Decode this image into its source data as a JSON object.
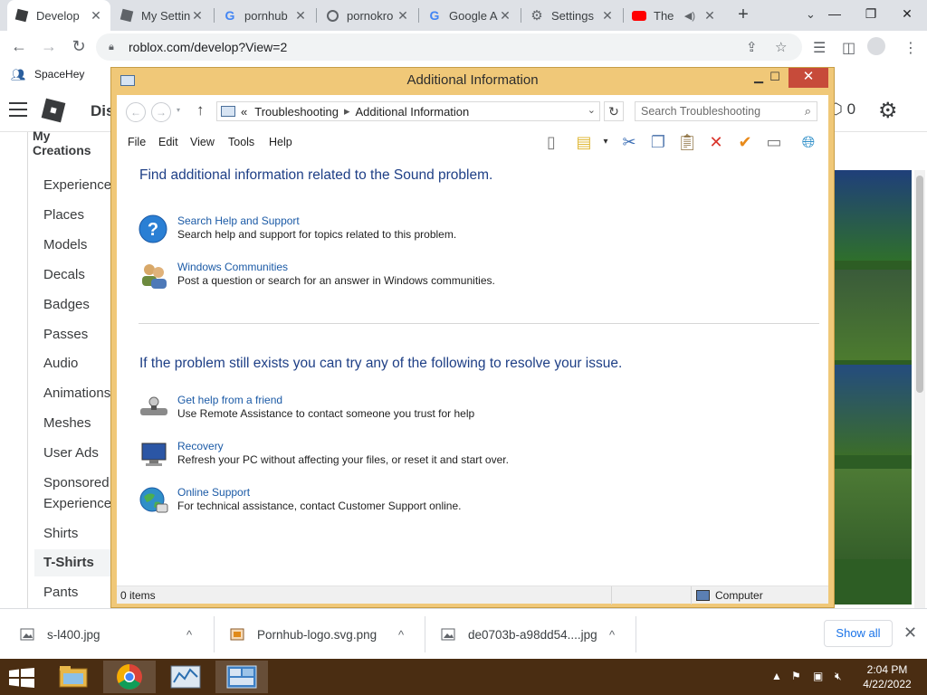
{
  "browser": {
    "tabs": [
      {
        "title": "Develop",
        "icon": "roblox-icon",
        "active": true
      },
      {
        "title": "My Settin",
        "icon": "roblox-icon",
        "active": false
      },
      {
        "title": "pornhub",
        "icon": "google-icon",
        "active": false
      },
      {
        "title": "pornokro",
        "icon": "globe-icon",
        "active": false
      },
      {
        "title": "Google A",
        "icon": "google-icon",
        "active": false
      },
      {
        "title": "Settings",
        "icon": "gear-icon",
        "active": false
      },
      {
        "title": "The",
        "icon": "youtube-icon",
        "active": false
      }
    ],
    "url": "roblox.com/develop?View=2",
    "bookmarks": [
      {
        "label": "SpaceHey"
      }
    ]
  },
  "roblox": {
    "header_title": "Dis",
    "robux": "0",
    "my_creations": "My Creations",
    "sidebar": [
      {
        "label": "Experiences"
      },
      {
        "label": "Places"
      },
      {
        "label": "Models"
      },
      {
        "label": "Decals"
      },
      {
        "label": "Badges"
      },
      {
        "label": "Passes"
      },
      {
        "label": "Audio"
      },
      {
        "label": "Animations"
      },
      {
        "label": "Meshes"
      },
      {
        "label": "User Ads"
      },
      {
        "label": "Sponsored"
      },
      {
        "label": "Experience"
      },
      {
        "label": "Shirts"
      },
      {
        "label": "T-Shirts",
        "active": true
      },
      {
        "label": "Pants"
      }
    ]
  },
  "dialog": {
    "title": "Additional Information",
    "address": {
      "prefix": "«",
      "crumbs": [
        "Troubleshooting",
        "Additional Information"
      ]
    },
    "search_placeholder": "Search Troubleshooting",
    "menu": [
      "File",
      "Edit",
      "View",
      "Tools",
      "Help"
    ],
    "section1_heading": "Find additional information related to the Sound problem.",
    "section1_items": [
      {
        "title": "Search Help and Support",
        "desc": "Search help and support for topics related to this problem.",
        "icon": "help-question-icon"
      },
      {
        "title": "Windows Communities",
        "desc": "Post a question or search for an answer in Windows communities.",
        "icon": "users-icon"
      }
    ],
    "section2_heading": "If the problem still exists you can try any of the following to resolve your issue.",
    "section2_items": [
      {
        "title": "Get help from a friend",
        "desc": "Use Remote Assistance to contact someone you trust for help",
        "icon": "remote-assistance-icon"
      },
      {
        "title": "Recovery",
        "desc": "Refresh your PC without affecting your files, or reset it and start over.",
        "icon": "recovery-icon"
      },
      {
        "title": "Online Support",
        "desc": "For technical assistance, contact Customer Support online.",
        "icon": "globe-support-icon"
      }
    ],
    "status_left": "0 items",
    "status_right": "Computer"
  },
  "downloads": {
    "items": [
      {
        "name": "s-l400.jpg"
      },
      {
        "name": "Pornhub-logo.svg.png"
      },
      {
        "name": "de0703b-a98dd54....jpg"
      }
    ],
    "show_all": "Show all"
  },
  "taskbar": {
    "time": "2:04 PM",
    "date": "4/22/2022"
  },
  "colors": {
    "dialog_frame": "#f0c878",
    "link_blue": "#1b5aa6",
    "heading_blue": "#1e3f86",
    "taskbar": "#4a2d12"
  }
}
